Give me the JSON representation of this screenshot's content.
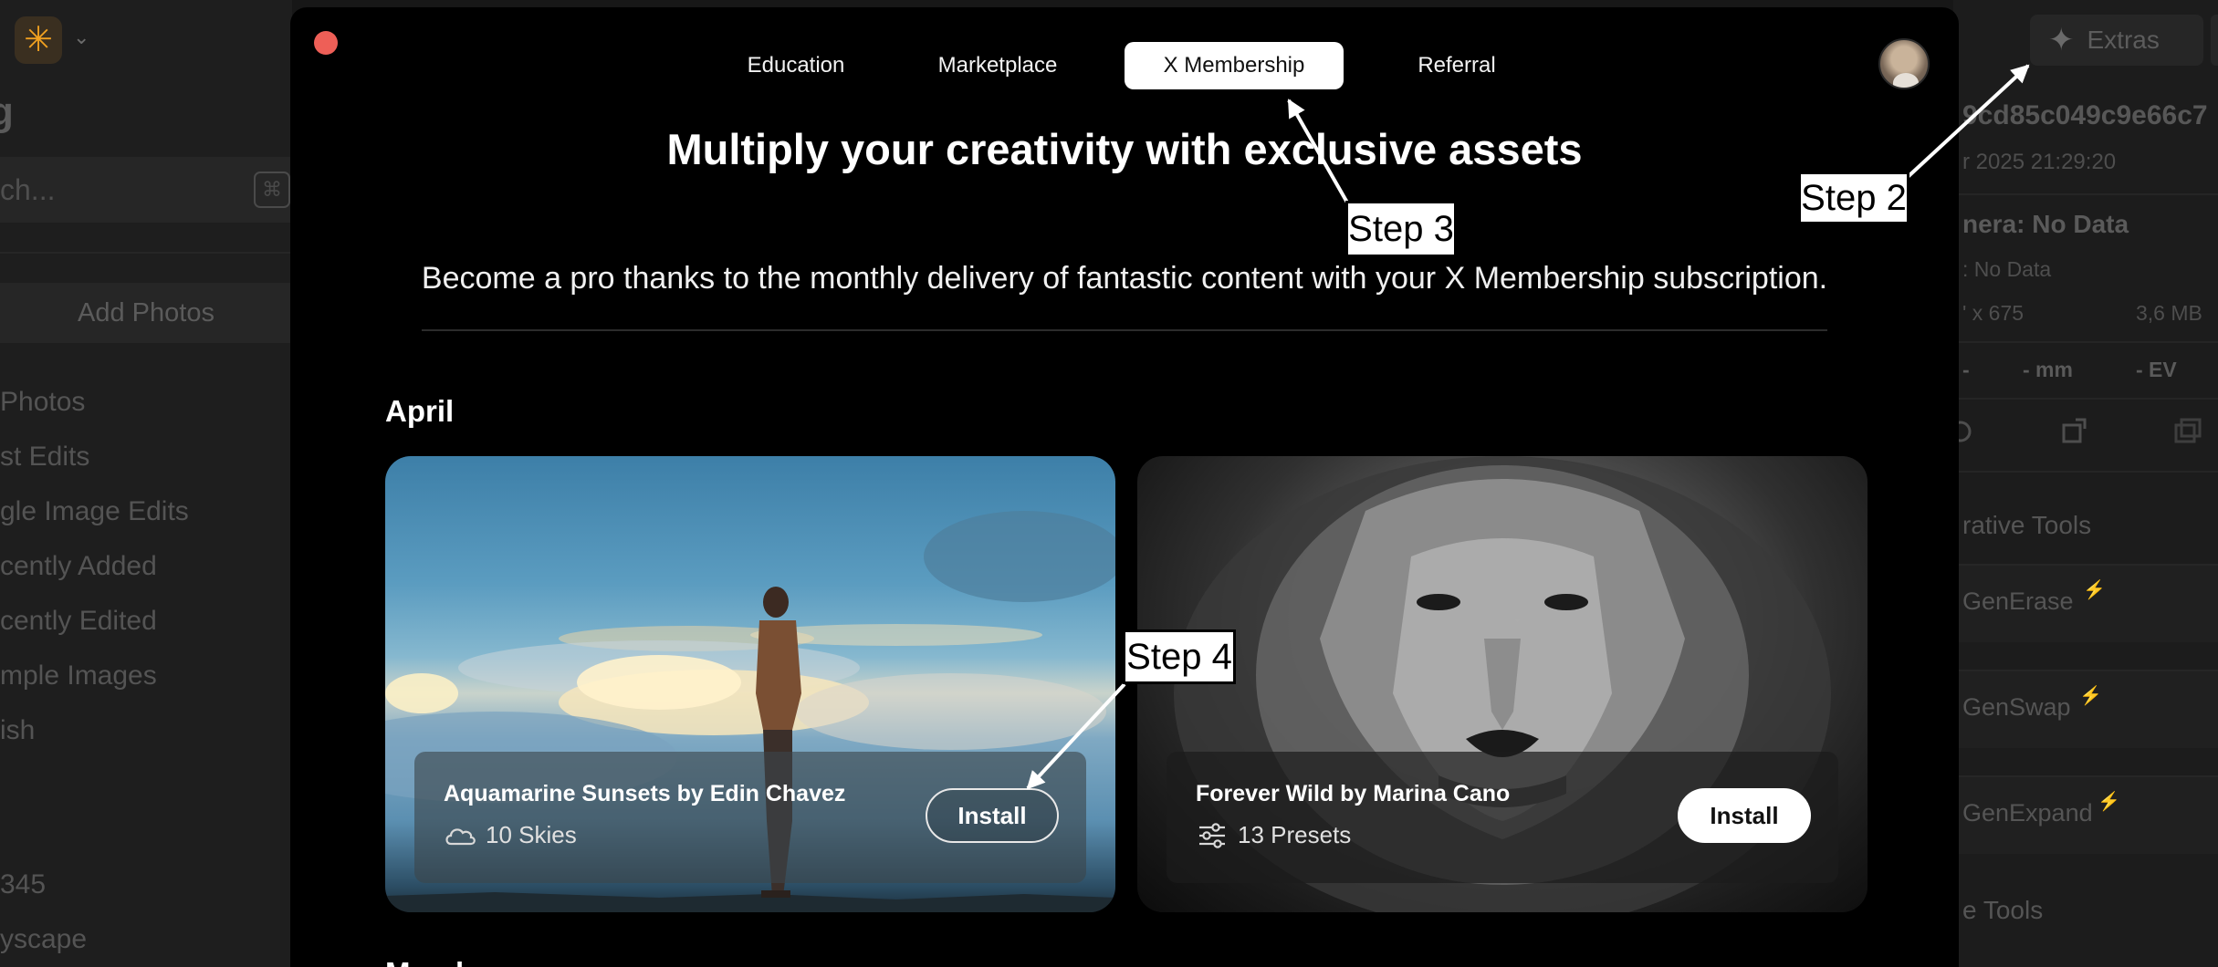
{
  "sidebar": {
    "title": "g",
    "search_placeholder": "ch...",
    "search_shortcut": "⌘",
    "add_photos": "Add Photos",
    "nav": [
      {
        "label": "Photos"
      },
      {
        "label": "st Edits"
      },
      {
        "label": "gle Image Edits"
      },
      {
        "label": "cently Added"
      },
      {
        "label": "cently Edited"
      },
      {
        "label": "mple Images"
      },
      {
        "label": "ish"
      }
    ],
    "bottom": [
      {
        "label": "345"
      },
      {
        "label": "yscape"
      }
    ]
  },
  "right_panel": {
    "extras_label": "Extras",
    "hash": "9cd85c049c9e66c7",
    "date": "r 2025 21:29:20",
    "camera": "nera: No Data",
    "lens": ": No Data",
    "dims": "' x 675",
    "size": "3,6 MB",
    "dash": "-",
    "mm": "- mm",
    "ev": "- EV",
    "section_creative": "rative Tools",
    "tools": [
      {
        "label": "GenErase",
        "bolt_color": "#3aa868"
      },
      {
        "label": "GenSwap",
        "bolt_color": "#3a7ad8"
      },
      {
        "label": "GenExpand",
        "bolt_color": "#b040c8"
      }
    ],
    "section_tools": "e Tools"
  },
  "modal": {
    "tabs": [
      {
        "label": "Education",
        "active": false
      },
      {
        "label": "Marketplace",
        "active": false
      },
      {
        "label": "X Membership",
        "active": true
      },
      {
        "label": "Referral",
        "active": false
      }
    ],
    "headline": "Multiply your creativity with exclusive assets",
    "subheadline": "Become a pro thanks to the monthly delivery of fantastic content with your X Membership subscription.",
    "month": "April",
    "next_month": "March",
    "cards": [
      {
        "title": "Aquamarine Sunsets by Edin Chavez",
        "meta_icon": "cloud-icon",
        "meta": "10 Skies",
        "button": "Install"
      },
      {
        "title": "Forever Wild by Marina Cano",
        "meta_icon": "sliders-icon",
        "meta": "13 Presets",
        "button": "Install"
      }
    ]
  },
  "annotations": {
    "step2": "Step 2",
    "step3": "Step 3",
    "step4": "Step 4"
  },
  "colors": {
    "close_button": "#ee5f57",
    "accent_logo": "#f0a020",
    "modal_bg": "#000000"
  }
}
